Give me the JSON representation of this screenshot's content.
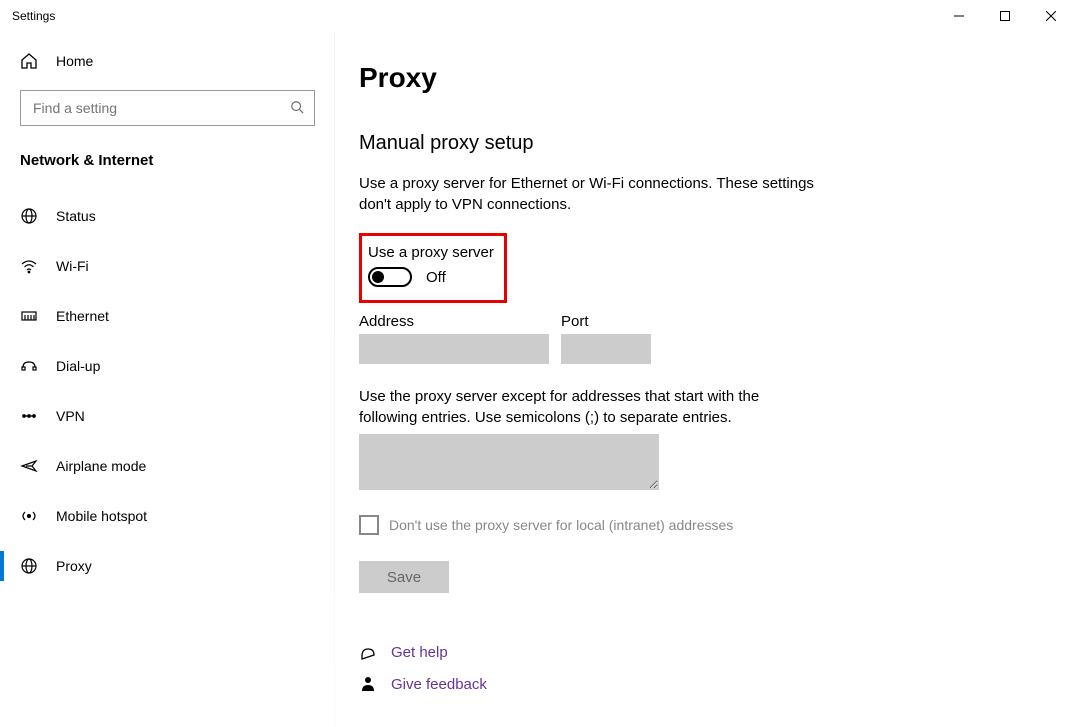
{
  "window": {
    "title": "Settings"
  },
  "sidebar": {
    "home_label": "Home",
    "search_placeholder": "Find a setting",
    "section_title": "Network & Internet",
    "items": [
      {
        "label": "Status"
      },
      {
        "label": "Wi-Fi"
      },
      {
        "label": "Ethernet"
      },
      {
        "label": "Dial-up"
      },
      {
        "label": "VPN"
      },
      {
        "label": "Airplane mode"
      },
      {
        "label": "Mobile hotspot"
      },
      {
        "label": "Proxy"
      }
    ],
    "selected_index": 7
  },
  "main": {
    "page_title": "Proxy",
    "section_title": "Manual proxy setup",
    "description": "Use a proxy server for Ethernet or Wi-Fi connections. These settings don't apply to VPN connections.",
    "toggle_label": "Use a proxy server",
    "toggle_state": "Off",
    "address_label": "Address",
    "address_value": "",
    "port_label": "Port",
    "port_value": "",
    "exceptions_desc": "Use the proxy server except for addresses that start with the following entries. Use semicolons (;) to separate entries.",
    "exceptions_value": "",
    "local_bypass_label": "Don't use the proxy server for local (intranet) addresses",
    "local_bypass_checked": false,
    "save_label": "Save",
    "help_label": "Get help",
    "feedback_label": "Give feedback"
  }
}
